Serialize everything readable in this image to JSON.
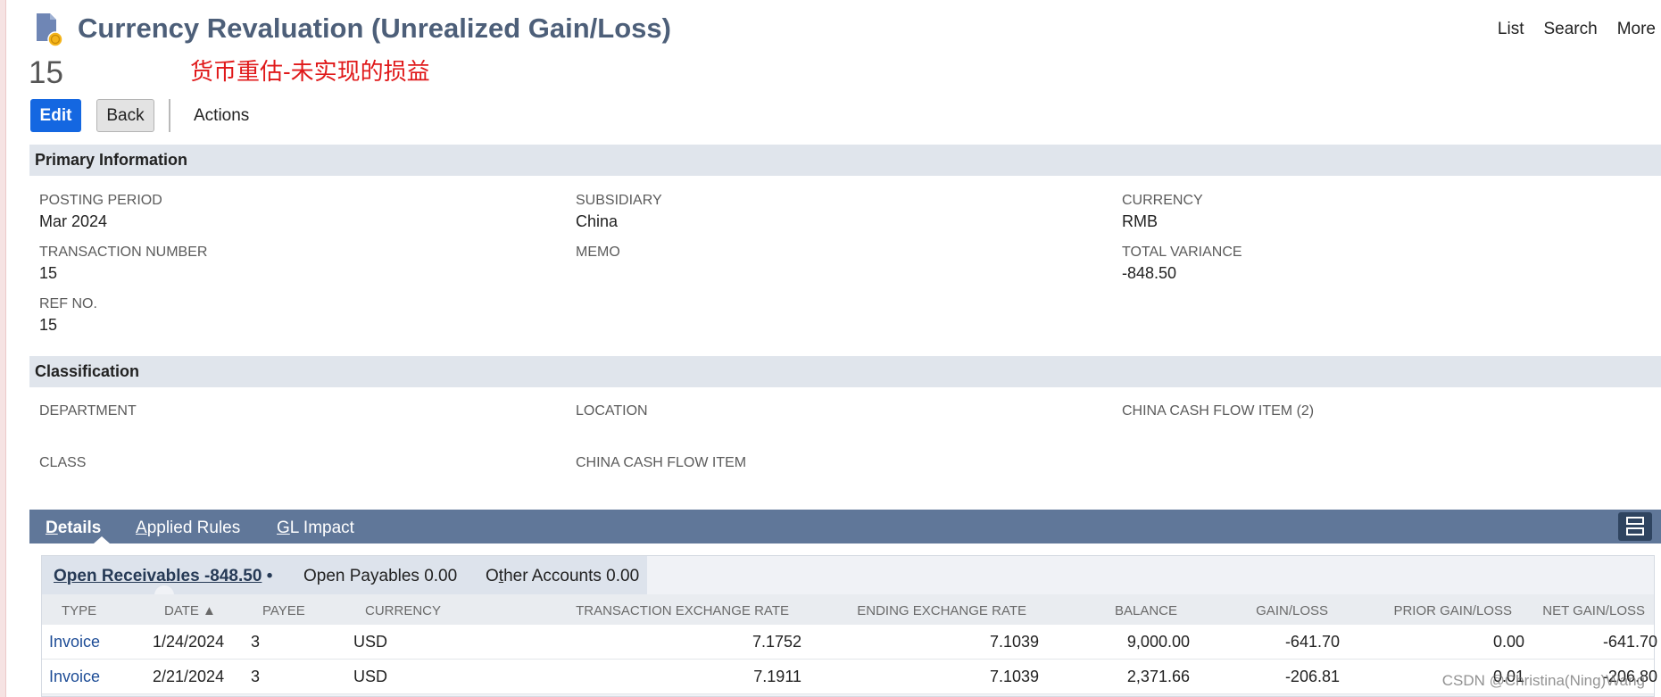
{
  "header": {
    "title": "Currency Revaluation (Unrealized Gain/Loss)",
    "record_number": "15",
    "note_cn": "货币重估-未实现的损益",
    "nav": [
      "List",
      "Search",
      "More"
    ]
  },
  "actions": {
    "edit": "Edit",
    "back": "Back",
    "actions": "Actions"
  },
  "primary": {
    "section_title": "Primary Information",
    "fields": [
      {
        "label": "POSTING PERIOD",
        "value": "Mar 2024"
      },
      {
        "label": "SUBSIDIARY",
        "value": "China"
      },
      {
        "label": "CURRENCY",
        "value": "RMB"
      },
      {
        "label": "TRANSACTION NUMBER",
        "value": "15"
      },
      {
        "label": "MEMO",
        "value": ""
      },
      {
        "label": "TOTAL VARIANCE",
        "value": "-848.50"
      },
      {
        "label": "REF NO.",
        "value": "15"
      }
    ]
  },
  "classification": {
    "section_title": "Classification",
    "fields": [
      {
        "label": "DEPARTMENT",
        "value": ""
      },
      {
        "label": "LOCATION",
        "value": ""
      },
      {
        "label": "CHINA CASH FLOW ITEM (2)",
        "value": ""
      },
      {
        "label": "CLASS",
        "value": ""
      },
      {
        "label": "CHINA CASH FLOW ITEM",
        "value": ""
      }
    ]
  },
  "tabs": [
    {
      "key": "D",
      "rest": "etails",
      "active": true
    },
    {
      "key": "A",
      "rest": "pplied Rules",
      "active": false
    },
    {
      "key": "G",
      "rest": "L Impact",
      "active": false
    }
  ],
  "subtabs": {
    "open_receivables": {
      "key": "O",
      "rest": "pen Receivables -848.50",
      "bullet": "•"
    },
    "open_payables": "Open Payables 0.00",
    "other_accounts": {
      "pre": "O",
      "key": "t",
      "rest": "her Accounts 0.00"
    }
  },
  "table": {
    "columns": [
      "TYPE",
      "DATE ▲",
      "PAYEE",
      "CURRENCY",
      "TRANSACTION EXCHANGE RATE",
      "ENDING EXCHANGE RATE",
      "BALANCE",
      "GAIN/LOSS",
      "PRIOR GAIN/LOSS",
      "NET GAIN/LOSS"
    ],
    "rows": [
      [
        "Invoice",
        "1/24/2024",
        "3",
        "USD",
        "7.1752",
        "7.1039",
        "9,000.00",
        "-641.70",
        "0.00",
        "-641.70"
      ],
      [
        "Invoice",
        "2/21/2024",
        "3",
        "USD",
        "7.1911",
        "7.1039",
        "2,371.66",
        "-206.81",
        "0.01",
        "-206.80"
      ]
    ]
  },
  "watermark": "CSDN @Christina(Ning)Wang"
}
